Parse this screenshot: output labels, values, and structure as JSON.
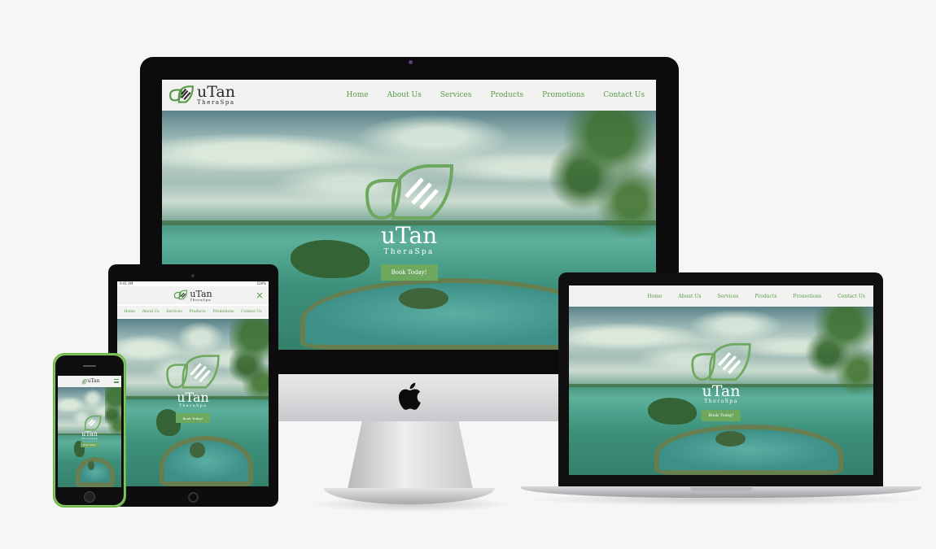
{
  "site": {
    "brand_title": "uTan",
    "brand_subtitle": "TheraSpa"
  },
  "nav": {
    "items": [
      "Home",
      "About Us",
      "Services",
      "Products",
      "Promotions",
      "Contact Us"
    ]
  },
  "hero": {
    "title": "uTan",
    "subtitle": "TheraSpa",
    "cta_label": "Book Today!"
  },
  "tablet": {
    "status_time": "9:41 AM",
    "status_battery": "100%",
    "close_icon": "×"
  },
  "colors": {
    "accent": "#6ea85f",
    "nav_text": "#5a9a4c",
    "header_bg": "#f2f2f0",
    "phone_case": "#8fd46a"
  },
  "icons": {
    "logo": "leaf-stripes-icon",
    "apple": "apple-logo-icon",
    "close": "close-icon",
    "menu": "hamburger-menu-icon"
  }
}
